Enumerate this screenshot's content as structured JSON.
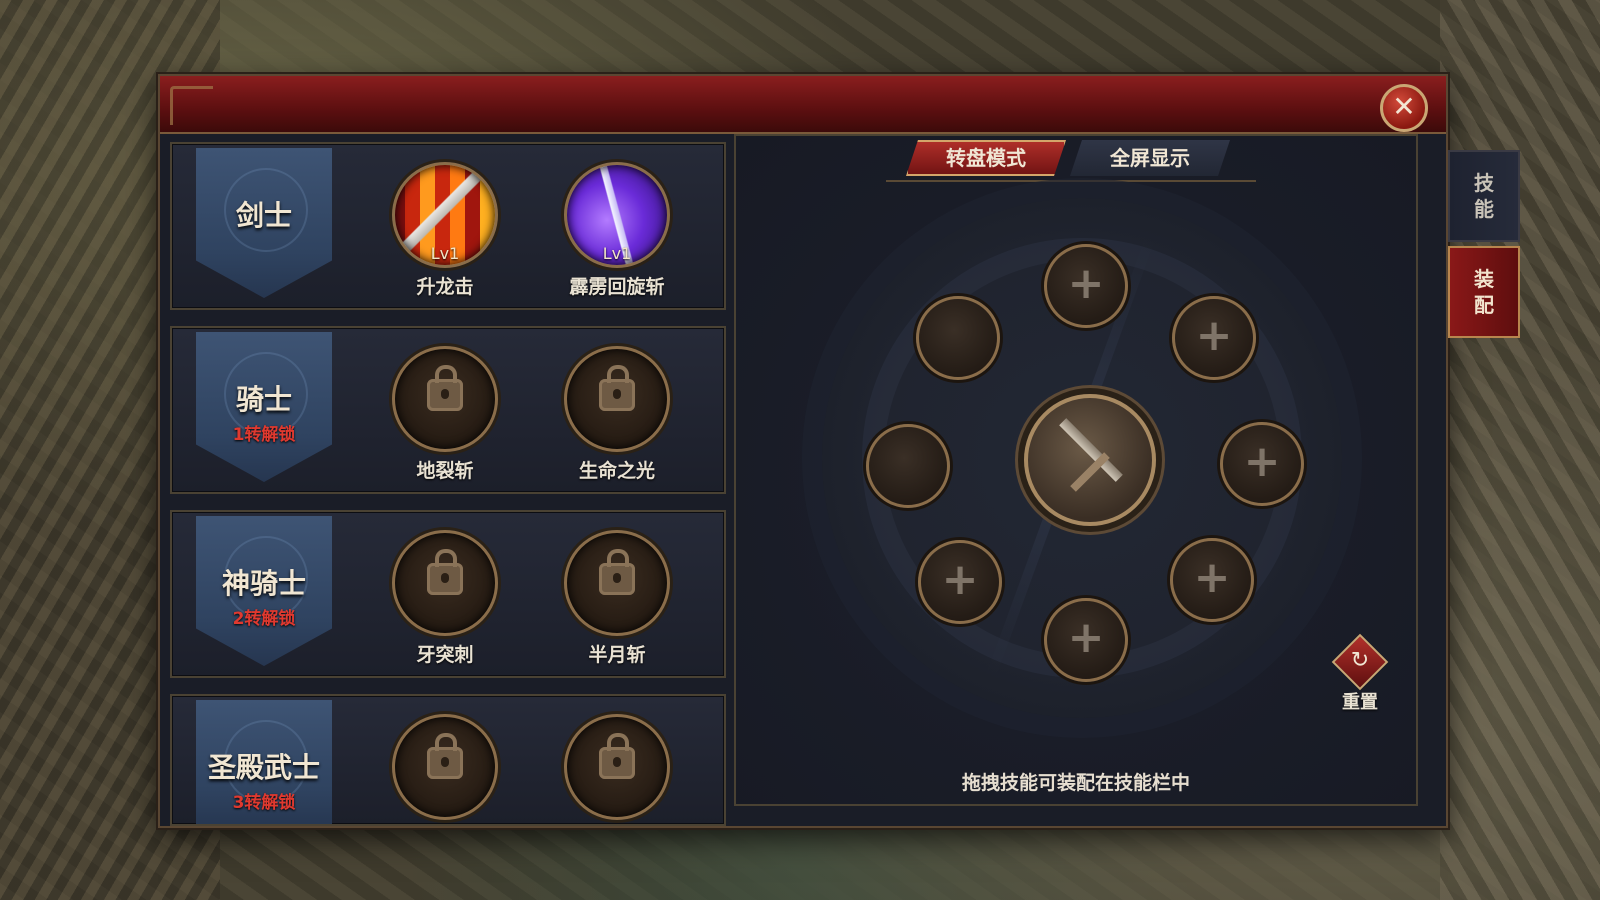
{
  "window": {
    "close_glyph": "✕"
  },
  "classes": [
    {
      "name": "剑士",
      "unlock": "",
      "skills": [
        {
          "name": "升龙击",
          "level": "Lv1",
          "icon": "dragon-strike-icon",
          "state": "unlocked"
        },
        {
          "name": "霹雳回旋斩",
          "level": "Lv1",
          "icon": "thunder-spin-icon",
          "state": "unlocked"
        }
      ]
    },
    {
      "name": "骑士",
      "unlock": "1转解锁",
      "skills": [
        {
          "name": "地裂斩",
          "icon": "lock-icon",
          "state": "locked"
        },
        {
          "name": "生命之光",
          "icon": "lock-icon",
          "state": "locked"
        }
      ]
    },
    {
      "name": "神骑士",
      "unlock": "2转解锁",
      "skills": [
        {
          "name": "牙突刺",
          "icon": "lock-icon",
          "state": "locked"
        },
        {
          "name": "半月斩",
          "icon": "lock-icon",
          "state": "locked"
        }
      ]
    },
    {
      "name": "圣殿武士",
      "unlock": "3转解锁",
      "skills": [
        {
          "name": "",
          "icon": "lock-icon",
          "state": "locked"
        },
        {
          "name": "",
          "icon": "lock-icon",
          "state": "locked"
        }
      ]
    }
  ],
  "tabs": {
    "wheel_mode": "转盘模式",
    "fullscreen": "全屏显示",
    "active": "wheel_mode"
  },
  "wheel": {
    "plus_glyph": "+",
    "slots": [
      {
        "id": "top",
        "content": "empty"
      },
      {
        "id": "upper-right",
        "content": "empty"
      },
      {
        "id": "right",
        "content": "empty"
      },
      {
        "id": "lower-right",
        "content": "empty"
      },
      {
        "id": "bottom",
        "content": "empty"
      },
      {
        "id": "lower-left",
        "content": "empty"
      },
      {
        "id": "left",
        "content": "dragon-strike-icon"
      },
      {
        "id": "upper-left",
        "content": "thunder-spin-icon"
      }
    ]
  },
  "reset": {
    "glyph": "↻",
    "label": "重置"
  },
  "hint": "拖拽技能可装配在技能栏中",
  "side_tabs": [
    {
      "line1": "技",
      "line2": "能",
      "active": false
    },
    {
      "line1": "装",
      "line2": "配",
      "active": true
    }
  ],
  "colors": {
    "accent_red": "#8a1818",
    "gold_border": "#c9a774",
    "locked_text": "#e0392f"
  }
}
